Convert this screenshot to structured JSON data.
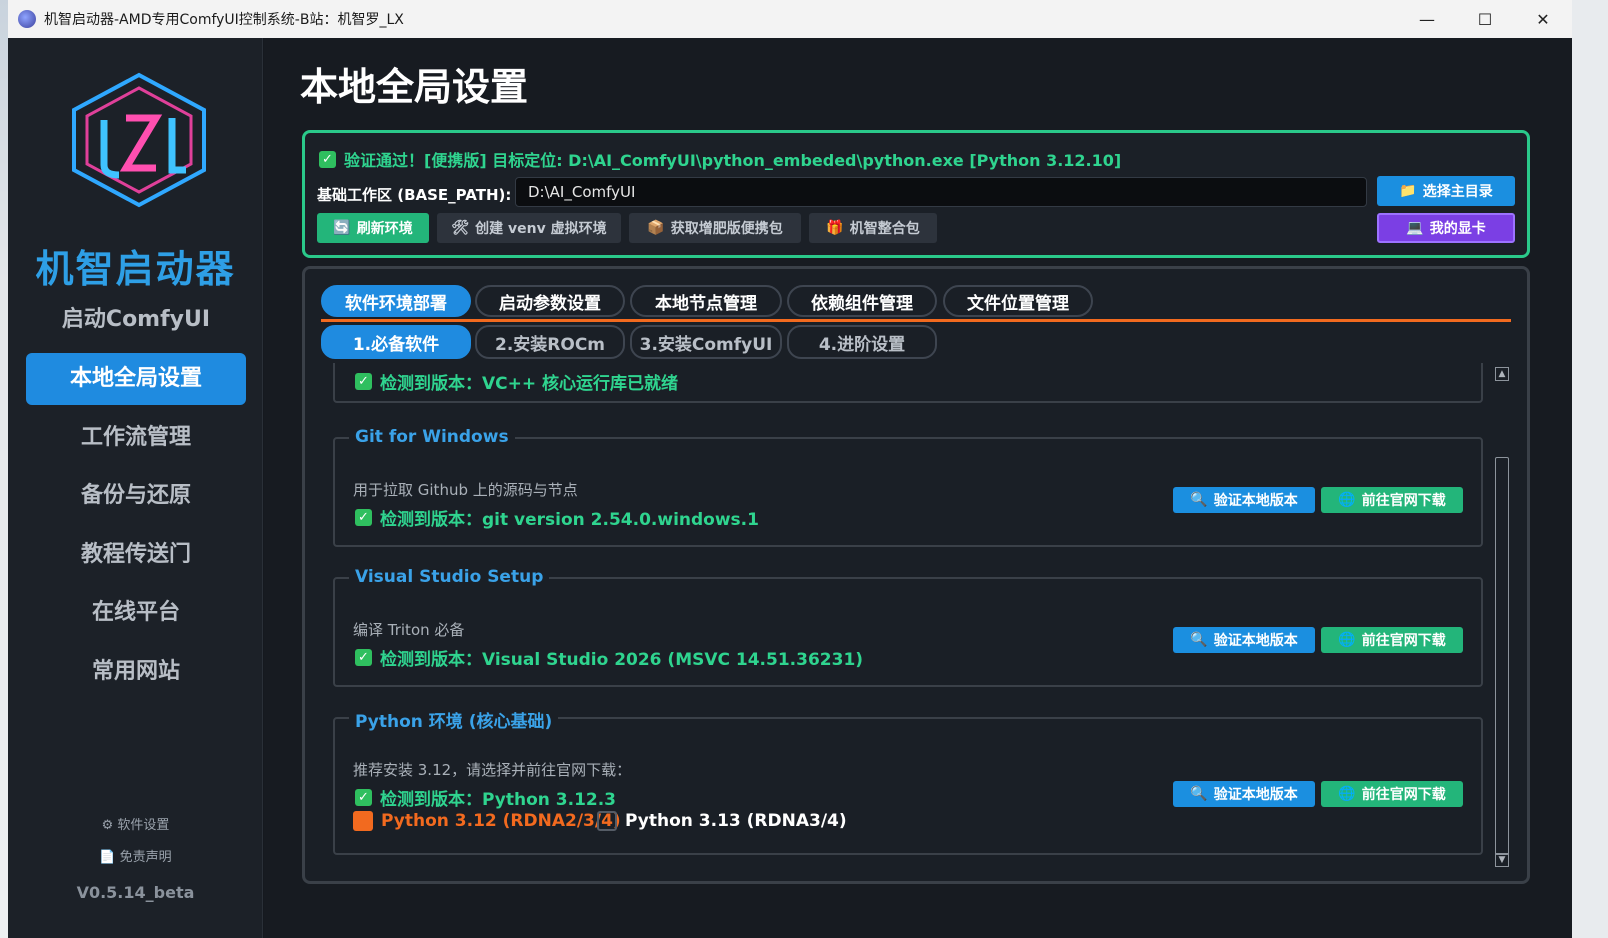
{
  "window": {
    "title": "机智启动器-AMD专用ComfyUI控制系统-B站：机智罗_LX",
    "controls": {
      "minimize": "—",
      "maximize": "☐",
      "close": "✕"
    }
  },
  "sidebar": {
    "brand": "机智启动器",
    "items": [
      {
        "label": "启动ComfyUI"
      },
      {
        "label": "本地全局设置"
      },
      {
        "label": "工作流管理"
      },
      {
        "label": "备份与还原"
      },
      {
        "label": "教程传送门"
      },
      {
        "label": "在线平台"
      },
      {
        "label": "常用网站"
      }
    ],
    "settings_label": "软件设置",
    "disclaimer_label": "免责声明",
    "version": "V0.5.14_beta"
  },
  "main": {
    "title": "本地全局设置",
    "status": {
      "message": "验证通过！[便携版] 目标定位: D:\\AI_ComfyUI\\python_embeded\\python.exe [Python 3.12.10]",
      "base_path_label": "基础工作区 (BASE_PATH):",
      "base_path_value": "D:\\AI_ComfyUI",
      "choose_dir_label": "选择主目录",
      "my_gpu_label": "我的显卡",
      "refresh_label": "刷新环境",
      "venv_label": "创建 venv 虚拟环境",
      "portable_label": "获取增肥版便携包",
      "bundle_label": "机智整合包"
    },
    "tabs": [
      {
        "label": "软件环境部署"
      },
      {
        "label": "启动参数设置"
      },
      {
        "label": "本地节点管理"
      },
      {
        "label": "依赖组件管理"
      },
      {
        "label": "文件位置管理"
      }
    ],
    "subtabs": [
      {
        "label": "1.必备软件"
      },
      {
        "label": "2.安装ROCm"
      },
      {
        "label": "3.安装ComfyUI"
      },
      {
        "label": "4.进阶设置"
      }
    ],
    "groups": {
      "vcpp": {
        "detected": "检测到版本：VC++ 核心运行库已就绪"
      },
      "git": {
        "title": "Git for Windows",
        "desc": "用于拉取 Github 上的源码与节点",
        "detected": "检测到版本：git version 2.54.0.windows.1",
        "verify_label": "验证本地版本",
        "download_label": "前往官网下载"
      },
      "vs": {
        "title": "Visual Studio Setup",
        "desc": "编译 Triton 必备",
        "detected": "检测到版本：Visual Studio 2026 (MSVC 14.51.36231)",
        "verify_label": "验证本地版本",
        "download_label": "前往官网下载"
      },
      "python": {
        "title": "Python 环境 (核心基础)",
        "desc": "推荐安装 3.12，请选择并前往官网下载：",
        "detected": "检测到版本：Python 3.12.3",
        "verify_label": "验证本地版本",
        "download_label": "前往官网下载",
        "option1": "Python 3.12 (RDNA2/3/4)",
        "option2": "Python 3.13 (RDNA3/4)"
      }
    }
  },
  "colors": {
    "accent_blue": "#1f8be0",
    "success_green": "#2fd48f",
    "orange": "#f26a1f",
    "purple": "#7b3fe4"
  }
}
